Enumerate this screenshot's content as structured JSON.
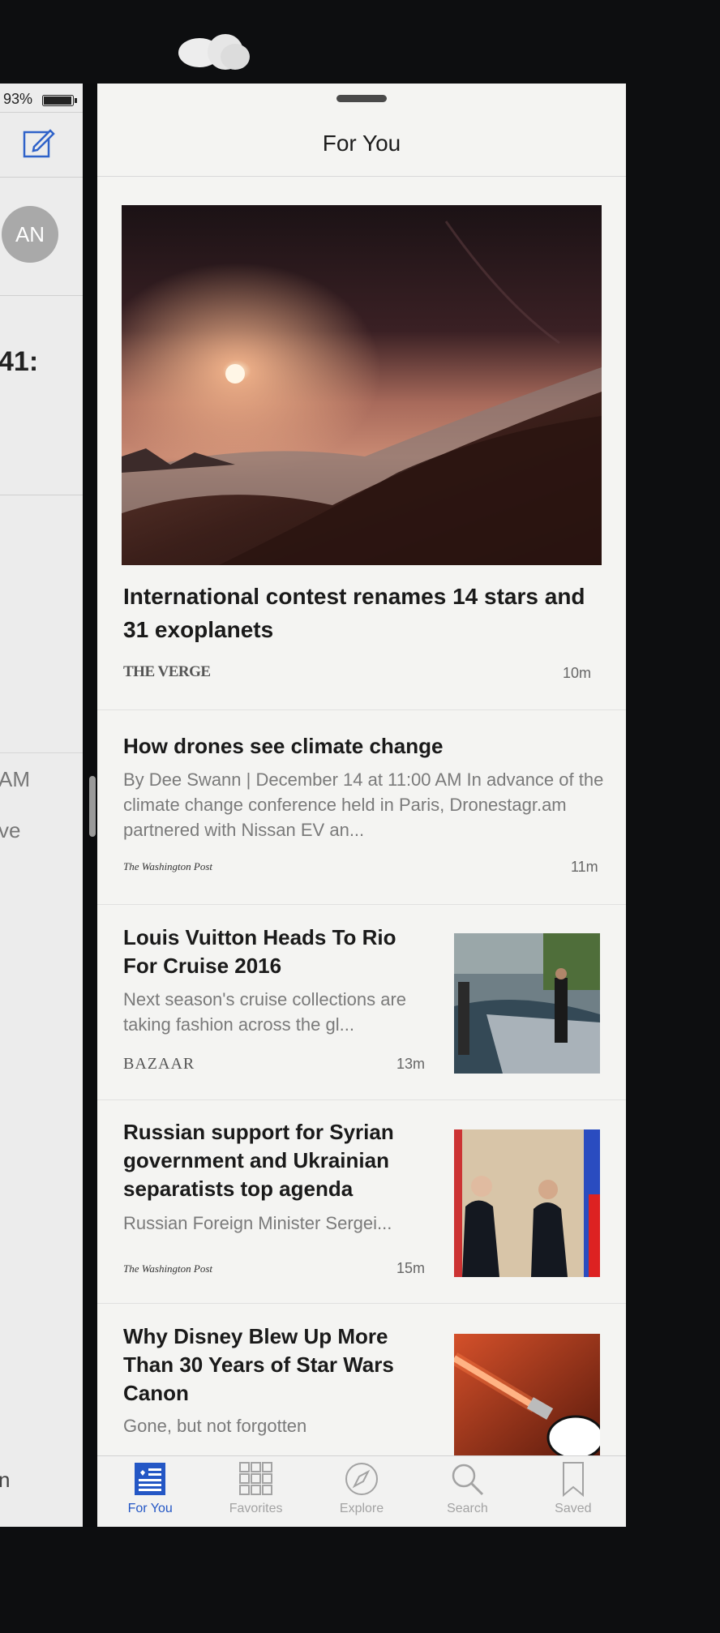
{
  "split_left": {
    "battery_text": "93%",
    "avatar_initials": "AN",
    "time_fragment": "41:",
    "am_fragment": "AM",
    "ve_fragment": "ve",
    "n_fragment": "n"
  },
  "header": {
    "title": "For You"
  },
  "feed": {
    "hero": {
      "title": "International contest renames 14 stars and 31 exoplanets",
      "source": "THE VERGE",
      "time": "10m"
    },
    "items": [
      {
        "title": "How drones see climate change",
        "summary": "By Dee Swann | December 14 at 11:00 AM In advance of the climate change conference held in Paris, Dronestagr.am partnered with Nissan EV an...",
        "source": "The Washington Post",
        "time": "11m"
      },
      {
        "title": "Louis Vuitton Heads To Rio For Cruise 2016",
        "summary": "Next season's cruise collections are taking fashion across the gl...",
        "source": "BAZAAR",
        "time": "13m"
      },
      {
        "title": "Russian support for Syrian government and Ukrainian separatists top agenda",
        "summary": "Russian Foreign Minister Sergei...",
        "source": "The Washington Post",
        "time": "15m"
      },
      {
        "title": "Why Disney Blew Up More Than 30 Years of Star Wars Canon",
        "summary": "Gone, but not forgotten"
      }
    ]
  },
  "tabs": [
    {
      "label": "For You",
      "icon": "news-grid-icon",
      "active": true
    },
    {
      "label": "Favorites",
      "icon": "favorites-grid-icon",
      "active": false
    },
    {
      "label": "Explore",
      "icon": "compass-icon",
      "active": false
    },
    {
      "label": "Search",
      "icon": "magnifier-icon",
      "active": false
    },
    {
      "label": "Saved",
      "icon": "bookmark-icon",
      "active": false
    }
  ],
  "colors": {
    "accent": "#2457c5",
    "inactive_tab": "#a3a3a3",
    "panel_bg": "#f4f4f2"
  }
}
